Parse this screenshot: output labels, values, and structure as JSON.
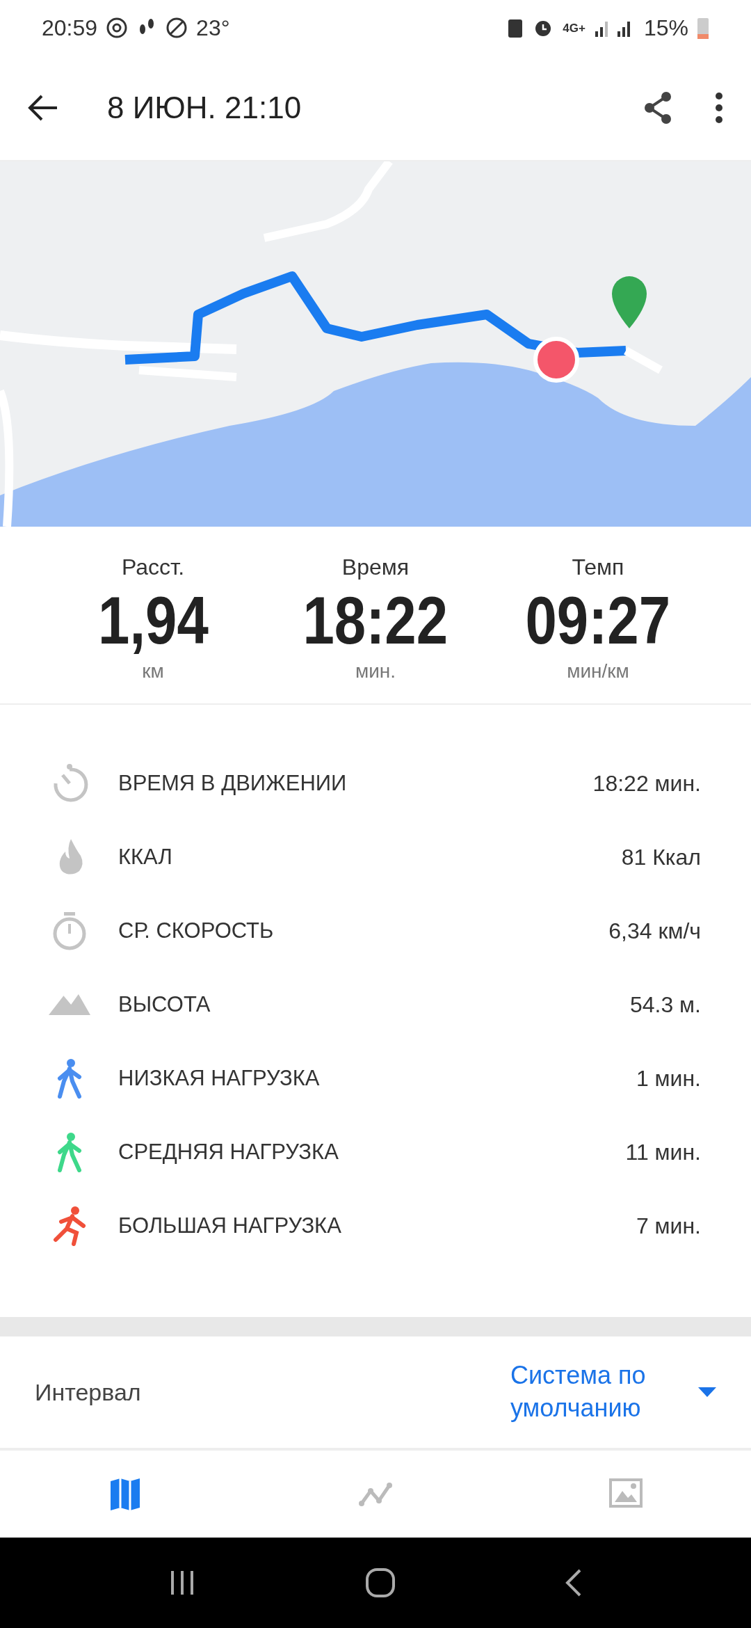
{
  "status_bar": {
    "time": "20:59",
    "temperature": "23°",
    "battery_text": "15%",
    "network": "4G+"
  },
  "toolbar": {
    "title": "8 ИЮН. 21:10"
  },
  "summary": [
    {
      "label": "Расст.",
      "value": "1,94",
      "unit": "км"
    },
    {
      "label": "Время",
      "value": "18:22",
      "unit": "мин."
    },
    {
      "label": "Темп",
      "value": "09:27",
      "unit": "мин/км"
    }
  ],
  "details": [
    {
      "kind": "moving",
      "label": "ВРЕМЯ В ДВИЖЕНИИ",
      "value": "18:22 мин."
    },
    {
      "kind": "calories",
      "label": "ККАЛ",
      "value": "81 Ккал"
    },
    {
      "kind": "speed",
      "label": "СР. СКОРОСТЬ",
      "value": "6,34 км/ч"
    },
    {
      "kind": "altitude",
      "label": "ВЫСОТА",
      "value": "54.3 м."
    },
    {
      "kind": "walker",
      "label": "НИЗКАЯ НАГРУЗКА",
      "value": "1 мин.",
      "color": "#4a8ef0"
    },
    {
      "kind": "walker",
      "label": "СРЕДНЯЯ НАГРУЗКА",
      "value": "11 мин.",
      "color": "#3ed88a"
    },
    {
      "kind": "runner",
      "label": "БОЛЬШАЯ НАГРУЗКА",
      "value": "7 мин.",
      "color": "#f0503a"
    }
  ],
  "interval": {
    "label": "Интервал",
    "value": "Система по умолчанию"
  },
  "tabs": [
    {
      "kind": "map",
      "selected": true
    },
    {
      "kind": "chart",
      "selected": false
    },
    {
      "kind": "gallery",
      "selected": false
    }
  ]
}
